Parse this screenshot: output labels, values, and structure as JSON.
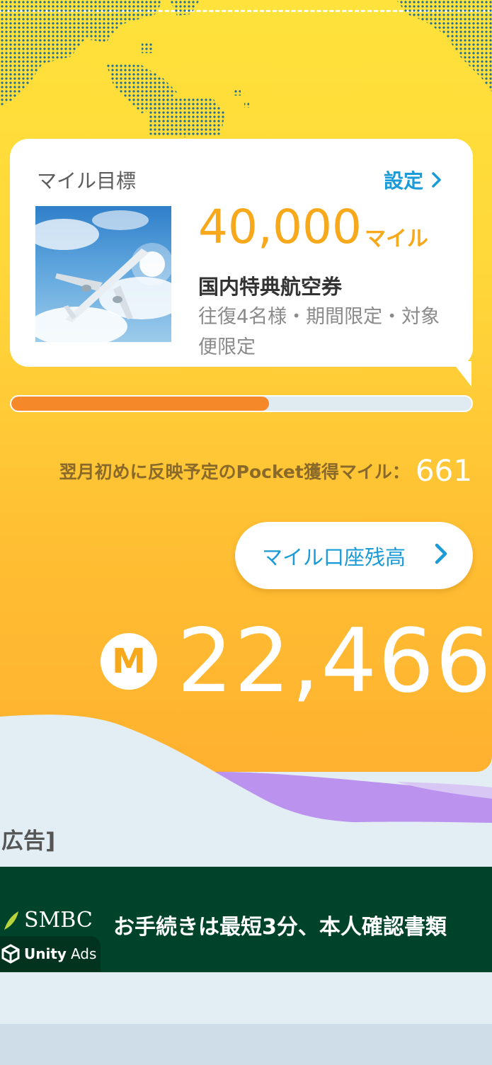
{
  "goal": {
    "title": "マイル目標",
    "settings_label": "設定",
    "miles": "40,000",
    "miles_unit": "マイル",
    "name": "国内特典航空券",
    "description": "往復4名様・期間限定・対象便限定"
  },
  "progress": {
    "fraction": 0.56
  },
  "pending": {
    "label": "翌月初めに反映予定のPocket獲得マイル：",
    "value": "661"
  },
  "account_button": {
    "label": "マイル口座残高"
  },
  "balance": {
    "badge": "M",
    "value": "22,466"
  },
  "ad": {
    "label": "広告]",
    "brand": "SMBC",
    "copy": "お手続きは最短3分、本人確認書類",
    "network_bold": "Unity",
    "network": "Ads"
  },
  "colors": {
    "accent": "#1a9ad6",
    "orange": "#f7a81b",
    "progress": "#f5892a"
  },
  "icons": {
    "settings": "chevron-right-icon",
    "account": "chevron-right-icon",
    "photo": "airplane-sky-photo"
  }
}
